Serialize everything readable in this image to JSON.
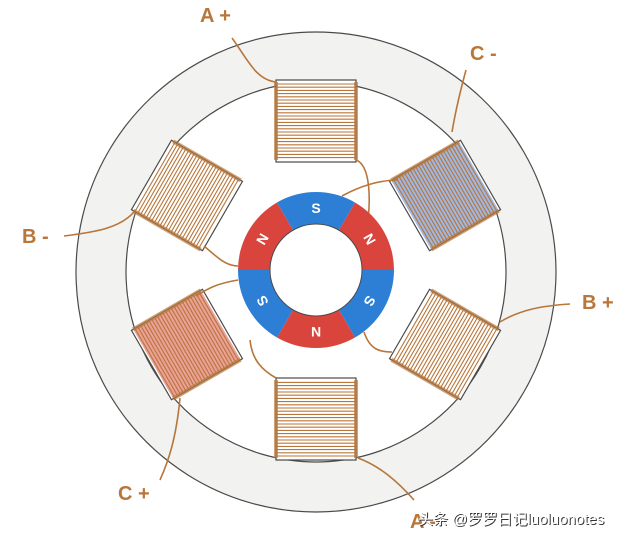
{
  "colors": {
    "stator_fill": "#f2f2f0",
    "stator_outline": "#4a4a4a",
    "coil_copper": "#b8763a",
    "coil_energized_blue": "#8eaadc",
    "coil_energized_red": "#e88f86",
    "rotor_red": "#d9453d",
    "rotor_blue": "#2d7fd6",
    "label": "#b8763a"
  },
  "labels": {
    "a_plus": "A +",
    "a_minus": "A -",
    "b_plus": "B +",
    "b_minus": "B -",
    "c_plus": "C +",
    "c_minus": "C -"
  },
  "rotor": {
    "poles": [
      "S",
      "N",
      "S",
      "N",
      "S",
      "N"
    ]
  },
  "watermark": "头条 @罗罗日记luoluonotes"
}
